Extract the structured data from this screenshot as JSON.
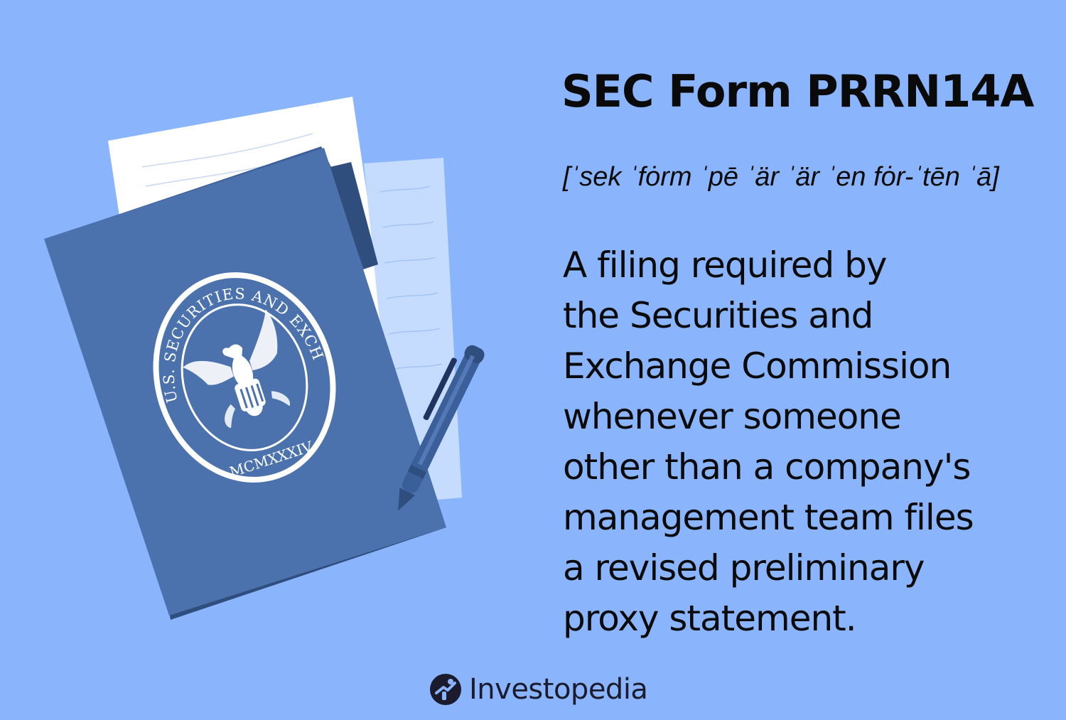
{
  "title": "SEC Form PRRN14A",
  "pronunciation": "[ˈsek ˈfȯrm ˈpē ˈär ˈär ˈen fȯr-ˈtēn ˈā]",
  "definition_lines": [
    "A filing required by",
    "the Securities and",
    "Exchange Commission",
    "whenever someone",
    "other than a company's",
    "management team files",
    "a revised preliminary",
    "proxy statement."
  ],
  "seal": {
    "ring_text": "U.S. SECURITIES AND EXCHANGE COMMISSION",
    "year": "MCMXXXIV"
  },
  "brand": {
    "name": "Investopedia",
    "icon": "investopedia-logo-icon"
  },
  "colors": {
    "background": "#8ab5fd",
    "folder": "#4b70ab",
    "folder_dark": "#2f4d7d",
    "pen": "#3a5f99",
    "text": "#0a0a0a"
  }
}
